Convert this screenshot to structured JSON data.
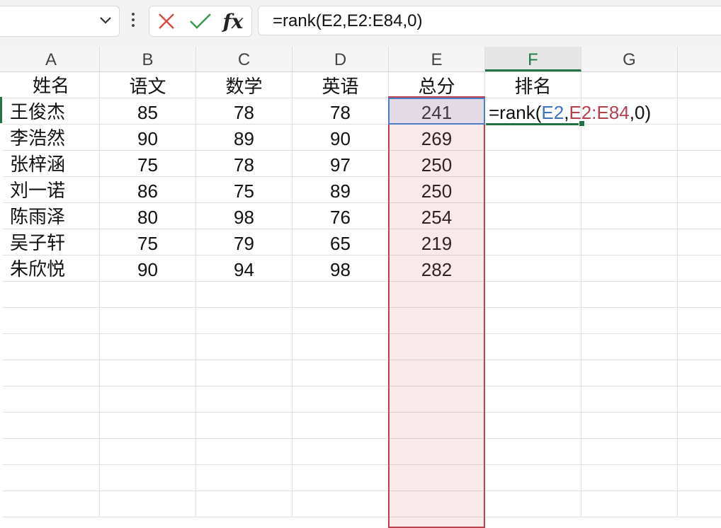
{
  "formula_bar": {
    "formula": "=rank(E2,E2:E84,0)",
    "cancel_icon": "close-icon",
    "enter_icon": "check-icon",
    "fx_label": "fx"
  },
  "columns": [
    "A",
    "B",
    "C",
    "D",
    "E",
    "F",
    "G"
  ],
  "active_column": "F",
  "headers": [
    "姓名",
    "语文",
    "数学",
    "英语",
    "总分",
    "排名"
  ],
  "rows": [
    [
      "王俊杰",
      "85",
      "78",
      "78",
      "241"
    ],
    [
      "李浩然",
      "90",
      "89",
      "90",
      "269"
    ],
    [
      "张梓涵",
      "75",
      "78",
      "97",
      "250"
    ],
    [
      "刘一诺",
      "86",
      "75",
      "89",
      "250"
    ],
    [
      "陈雨泽",
      "80",
      "98",
      "76",
      "254"
    ],
    [
      "吴子轩",
      "75",
      "79",
      "65",
      "219"
    ],
    [
      "朱欣悦",
      "90",
      "94",
      "98",
      "282"
    ]
  ],
  "in_cell_edit": {
    "prefix": "=rank(",
    "arg1": "E2",
    "sep1": ",",
    "arg2": "E2:E84",
    "suffix": ",0)"
  },
  "colors": {
    "accent": "#217346",
    "ref_blue": "#3f74bd",
    "ref_red": "#b4424d"
  }
}
